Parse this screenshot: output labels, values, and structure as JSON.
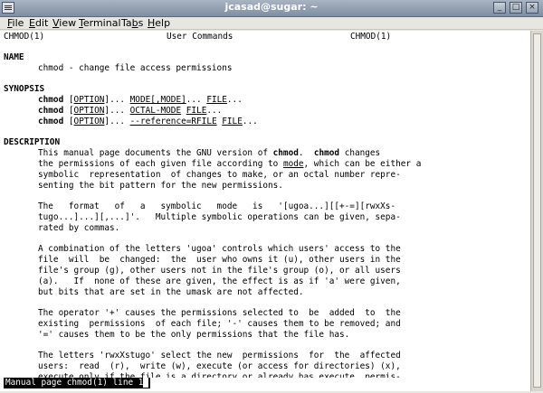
{
  "window": {
    "title": "jcasad@sugar: ~",
    "controls": {
      "minimize": "_",
      "maximize": "□",
      "close": "×"
    }
  },
  "menubar": {
    "items": [
      {
        "label": "File",
        "u": "F",
        "rest": "ile"
      },
      {
        "label": "Edit",
        "u": "E",
        "rest": "dit"
      },
      {
        "label": "View",
        "u": "V",
        "rest": "iew"
      },
      {
        "label": "Terminal",
        "u": "T",
        "rest": "erminal"
      },
      {
        "label": "Tabs",
        "pre": "Ta",
        "u": "b",
        "rest": "s"
      },
      {
        "label": "Help",
        "u": "H",
        "rest": "elp"
      }
    ]
  },
  "man": {
    "header_left": "CHMOD(1)",
    "header_center": "User Commands",
    "header_right": "CHMOD(1)",
    "name_heading": "NAME",
    "name_line": "chmod - change file access permissions",
    "synopsis_heading": "SYNOPSIS",
    "synopsis": [
      {
        "cmd": "chmod",
        "a": "[",
        "opt": "OPTION",
        "b": "]... ",
        "mode": "MODE[,MODE]",
        "c": "... ",
        "file": "FILE",
        "d": "..."
      },
      {
        "cmd": "chmod",
        "a": "[",
        "opt": "OPTION",
        "b": "]... ",
        "mode": "OCTAL-MODE",
        "c": " ",
        "file": "FILE",
        "d": "..."
      },
      {
        "cmd": "chmod",
        "a": "[",
        "opt": "OPTION",
        "b": "]... ",
        "mode": "--reference=RFILE",
        "c": " ",
        "file": "FILE",
        "d": "..."
      }
    ],
    "description_heading": "DESCRIPTION",
    "desc_p1": {
      "l1a": "This manual page documents the GNU version of ",
      "l1b": "chmod",
      "l1c": ".  ",
      "l1d": "chmod",
      "l1e": " changes",
      "l2a": "the permissions of each given file according to ",
      "l2b": "mode",
      "l2c": ", which can be either a",
      "l3": "symbolic  representation  of changes to make, or an octal number repre-",
      "l4": "senting the bit pattern for the new permissions."
    },
    "desc_p2": [
      "The   format   of   a   symbolic   mode   is   '[ugoa...][[+-=][rwxXs-",
      "tugo...]...][,...]'.   Multiple symbolic operations can be given, sepa-",
      "rated by commas."
    ],
    "desc_p3": [
      "A combination of the letters 'ugoa' controls which users' access to the",
      "file  will  be  changed:  the  user who owns it (u), other users in the",
      "file's group (g), other users not in the file's group (o), or all users",
      "(a).   If  none of these are given, the effect is as if 'a' were given,",
      "but bits that are set in the umask are not affected."
    ],
    "desc_p4": [
      "The operator '+' causes the permissions selected to  be  added  to  the",
      "existing  permissions  of each file; '-' causes them to be removed; and",
      "'=' causes them to be the only permissions that the file has."
    ],
    "desc_p5": [
      "The letters 'rwxXstugo' select the new  permissions  for  the  affected",
      "users:  read  (r),  write (w), execute (or access for directories) (x),",
      "execute only if the file is a directory or already has execute  permis-"
    ],
    "status_line": "Manual page chmod(1) line 1"
  }
}
